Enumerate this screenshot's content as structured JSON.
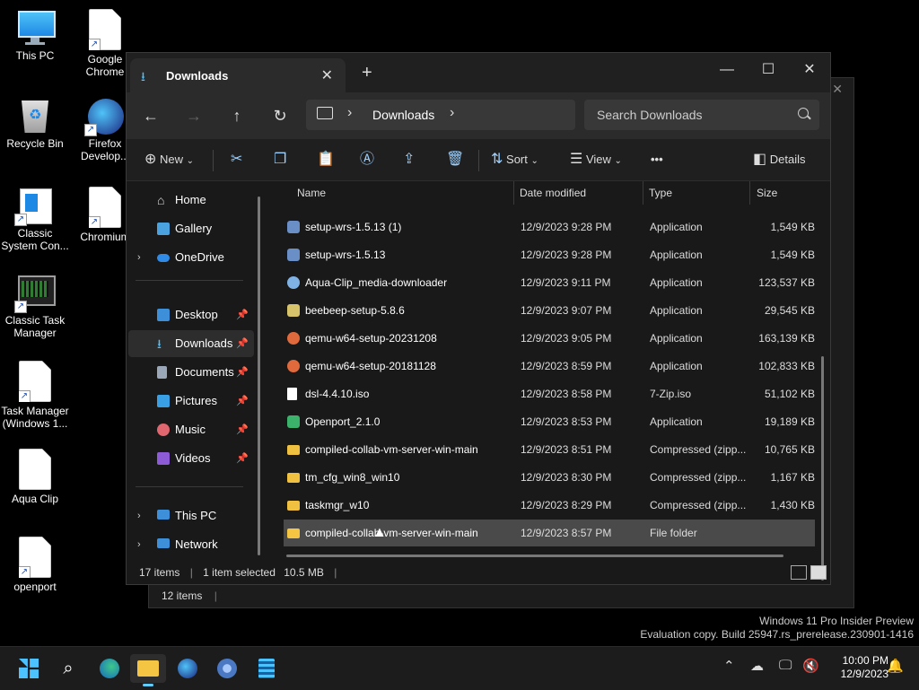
{
  "desktop": {
    "icons": [
      {
        "label": "This PC"
      },
      {
        "label": "Google Chrome"
      },
      {
        "label": "Recycle Bin"
      },
      {
        "label": "Firefox Develop..."
      },
      {
        "label": "Classic System Con..."
      },
      {
        "label": "Chromium"
      },
      {
        "label": "Classic Task Manager"
      },
      {
        "label": "Task Manager (Windows 1..."
      },
      {
        "label": "Aqua Clip"
      },
      {
        "label": "openport"
      }
    ]
  },
  "background_window": {
    "status": "12 items"
  },
  "window": {
    "tab_title": "Downloads",
    "address": "Downloads",
    "search_placeholder": "Search Downloads",
    "toolbar": {
      "new_label": "New",
      "sort_label": "Sort",
      "view_label": "View",
      "details_label": "Details",
      "more_label": "•••"
    },
    "sidebar": {
      "items": [
        {
          "label": "Home"
        },
        {
          "label": "Gallery"
        },
        {
          "label": "OneDrive"
        },
        {
          "label": "Desktop"
        },
        {
          "label": "Downloads"
        },
        {
          "label": "Documents"
        },
        {
          "label": "Pictures"
        },
        {
          "label": "Music"
        },
        {
          "label": "Videos"
        },
        {
          "label": "This PC"
        },
        {
          "label": "Network"
        }
      ]
    },
    "columns": {
      "name": "Name",
      "date": "Date modified",
      "type": "Type",
      "size": "Size"
    },
    "rows": [
      {
        "name": "setup-wrs-1.5.13 (1)",
        "date": "12/9/2023 9:28 PM",
        "type": "Application",
        "size": "1,549 KB",
        "kind": "app"
      },
      {
        "name": "setup-wrs-1.5.13",
        "date": "12/9/2023 9:28 PM",
        "type": "Application",
        "size": "1,549 KB",
        "kind": "app"
      },
      {
        "name": "Aqua-Clip_media-downloader",
        "date": "12/9/2023 9:11 PM",
        "type": "Application",
        "size": "123,537 KB",
        "kind": "app"
      },
      {
        "name": "beebeep-setup-5.8.6",
        "date": "12/9/2023 9:07 PM",
        "type": "Application",
        "size": "29,545 KB",
        "kind": "app"
      },
      {
        "name": "qemu-w64-setup-20231208",
        "date": "12/9/2023 9:05 PM",
        "type": "Application",
        "size": "163,139 KB",
        "kind": "app"
      },
      {
        "name": "qemu-w64-setup-20181128",
        "date": "12/9/2023 8:59 PM",
        "type": "Application",
        "size": "102,833 KB",
        "kind": "app"
      },
      {
        "name": "dsl-4.4.10.iso",
        "date": "12/9/2023 8:58 PM",
        "type": "7-Zip.iso",
        "size": "51,102 KB",
        "kind": "iso"
      },
      {
        "name": "Openport_2.1.0",
        "date": "12/9/2023 8:53 PM",
        "type": "Application",
        "size": "19,189 KB",
        "kind": "app"
      },
      {
        "name": "compiled-collab-vm-server-win-main",
        "date": "12/9/2023 8:51 PM",
        "type": "Compressed (zipp...",
        "size": "10,765 KB",
        "kind": "zip"
      },
      {
        "name": "tm_cfg_win8_win10",
        "date": "12/9/2023 8:30 PM",
        "type": "Compressed (zipp...",
        "size": "1,167 KB",
        "kind": "zip"
      },
      {
        "name": "taskmgr_w10",
        "date": "12/9/2023 8:29 PM",
        "type": "Compressed (zipp...",
        "size": "1,430 KB",
        "kind": "zip"
      },
      {
        "name": "compiled-collab-vm-server-win-main",
        "date": "12/9/2023 8:57 PM",
        "type": "File folder",
        "size": "",
        "kind": "folder"
      }
    ],
    "status": {
      "items": "17 items",
      "selected": "1 item selected",
      "size": "10.5 MB"
    }
  },
  "watermark": {
    "line1": "Windows 11 Pro Insider Preview",
    "line2": "Evaluation copy. Build 25947.rs_prerelease.230901-1416"
  },
  "taskbar": {
    "time": "10:00 PM",
    "date": "12/9/2023"
  },
  "colors": {
    "accent": "#60cdff",
    "selection": "#4a4a4a"
  }
}
